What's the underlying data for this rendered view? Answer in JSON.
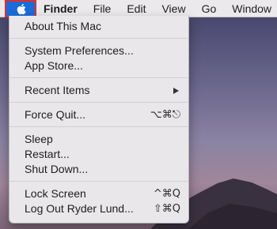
{
  "menubar": {
    "items": [
      {
        "label": "Finder",
        "bold": true
      },
      {
        "label": "File"
      },
      {
        "label": "Edit"
      },
      {
        "label": "View"
      },
      {
        "label": "Go"
      },
      {
        "label": "Window"
      }
    ]
  },
  "apple_menu": {
    "about": "About This Mac",
    "system_prefs": "System Preferences...",
    "app_store": "App Store...",
    "recent_items": "Recent Items",
    "force_quit": "Force Quit...",
    "force_quit_shortcut": "⌥⌘⎋",
    "sleep": "Sleep",
    "restart": "Restart...",
    "shut_down": "Shut Down...",
    "lock_screen": "Lock Screen",
    "lock_screen_shortcut": "^⌘Q",
    "log_out": "Log Out Ryder Lund...",
    "log_out_shortcut": "⇧⌘Q"
  },
  "icons": {
    "apple": "apple-logo-icon",
    "submenu": "chevron-right-icon"
  },
  "colors": {
    "accent": "#1b6bd9",
    "highlight_border": "#e0302a"
  }
}
